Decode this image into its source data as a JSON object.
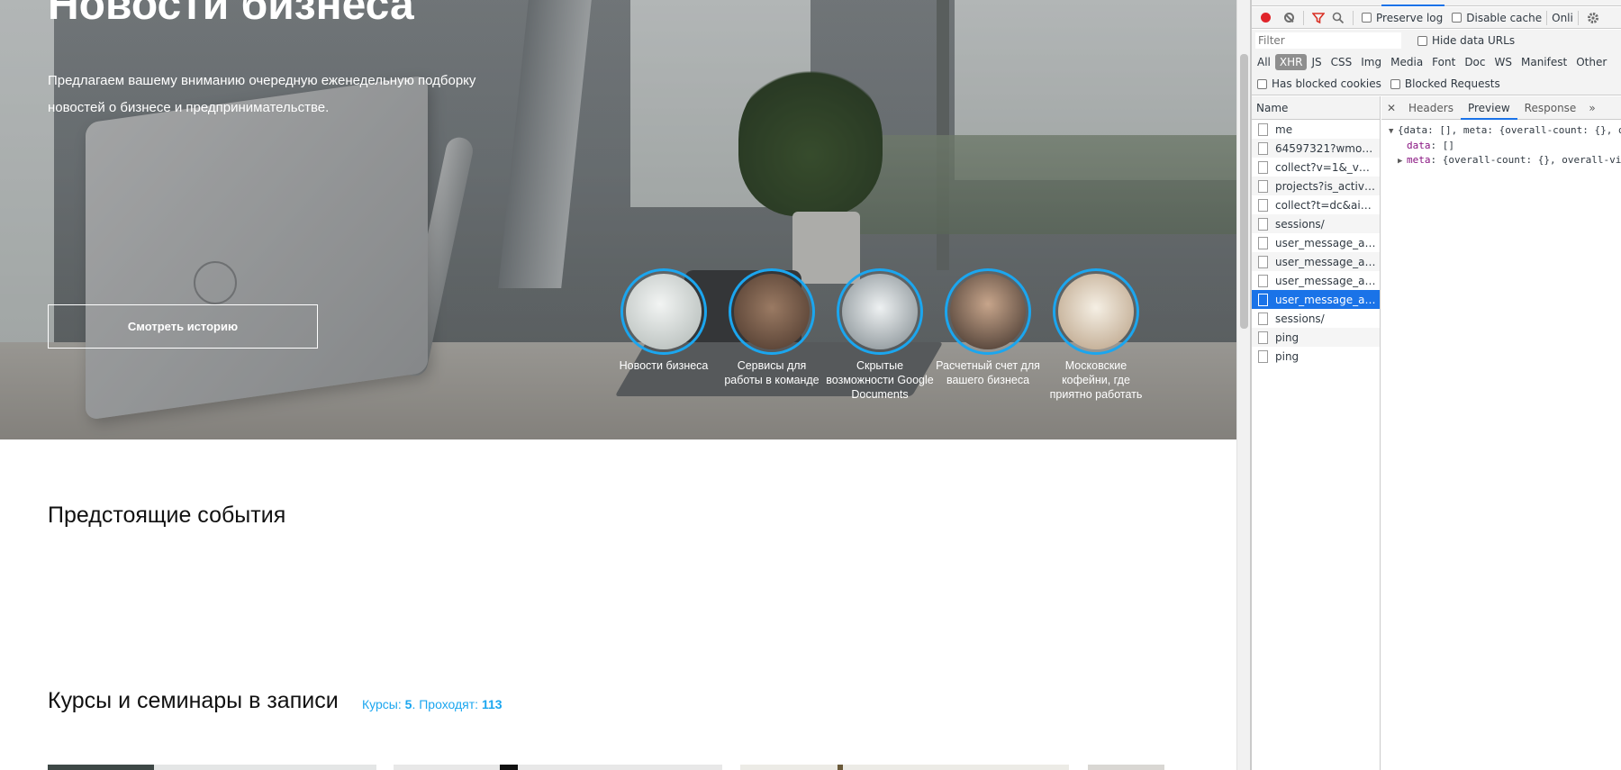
{
  "hero": {
    "title": "Новости бизнеса",
    "subtitle": "Предлагаем вашему вниманию очередную еженедельную подборку новостей о бизнесе и предпринимательстве.",
    "button_label": "Смотреть историю",
    "stories": [
      {
        "label": "Новости бизнеса",
        "color": "#c9d2cf"
      },
      {
        "label": "Сервисы для работы в команде",
        "color": "#7a5a44"
      },
      {
        "label": "Скрытые возможности Google Documents",
        "color": "#b7c1c6"
      },
      {
        "label": "Расчетный счет для вашего бизнеса",
        "color": "#5b4a3f"
      },
      {
        "label": "Московские кофейни, где приятно работать",
        "color": "#d8cbb8"
      }
    ]
  },
  "events": {
    "title": "Предстоящие события"
  },
  "courses": {
    "title": "Курсы и семинары в записи",
    "stats_prefix": "Курсы: ",
    "courses_count": "5",
    "stats_mid": ". Проходят: ",
    "attending_count": "113"
  },
  "devtools": {
    "toolbar": {
      "preserve_log": "Preserve log",
      "disable_cache": "Disable cache",
      "online": "Onli"
    },
    "filter_placeholder": "Filter",
    "hide_data_urls": "Hide data URLs",
    "types": [
      "All",
      "XHR",
      "JS",
      "CSS",
      "Img",
      "Media",
      "Font",
      "Doc",
      "WS",
      "Manifest",
      "Other"
    ],
    "active_type": "XHR",
    "has_blocked_cookies": "Has blocked cookies",
    "blocked_requests": "Blocked Requests",
    "name_header": "Name",
    "requests": [
      "me",
      "64597321?wmode...",
      "collect?v=1&_v=j8...",
      "projects?is_activit...",
      "collect?t=dc&aip=...",
      "sessions/",
      "user_message_ad...",
      "user_message_ad...",
      "user_message_ad...",
      "user_message_ad...",
      "sessions/",
      "ping",
      "ping"
    ],
    "selected_request_index": 9,
    "detail_tabs": [
      "Headers",
      "Preview",
      "Response"
    ],
    "active_detail_tab": "Preview",
    "preview": {
      "line1": "{data: [], meta: {overall-count: {}, o",
      "line2_key": "data",
      "line2_val": ": []",
      "line3_key": "meta",
      "line3_val": ": {overall-count: {}, overall-vi"
    }
  }
}
